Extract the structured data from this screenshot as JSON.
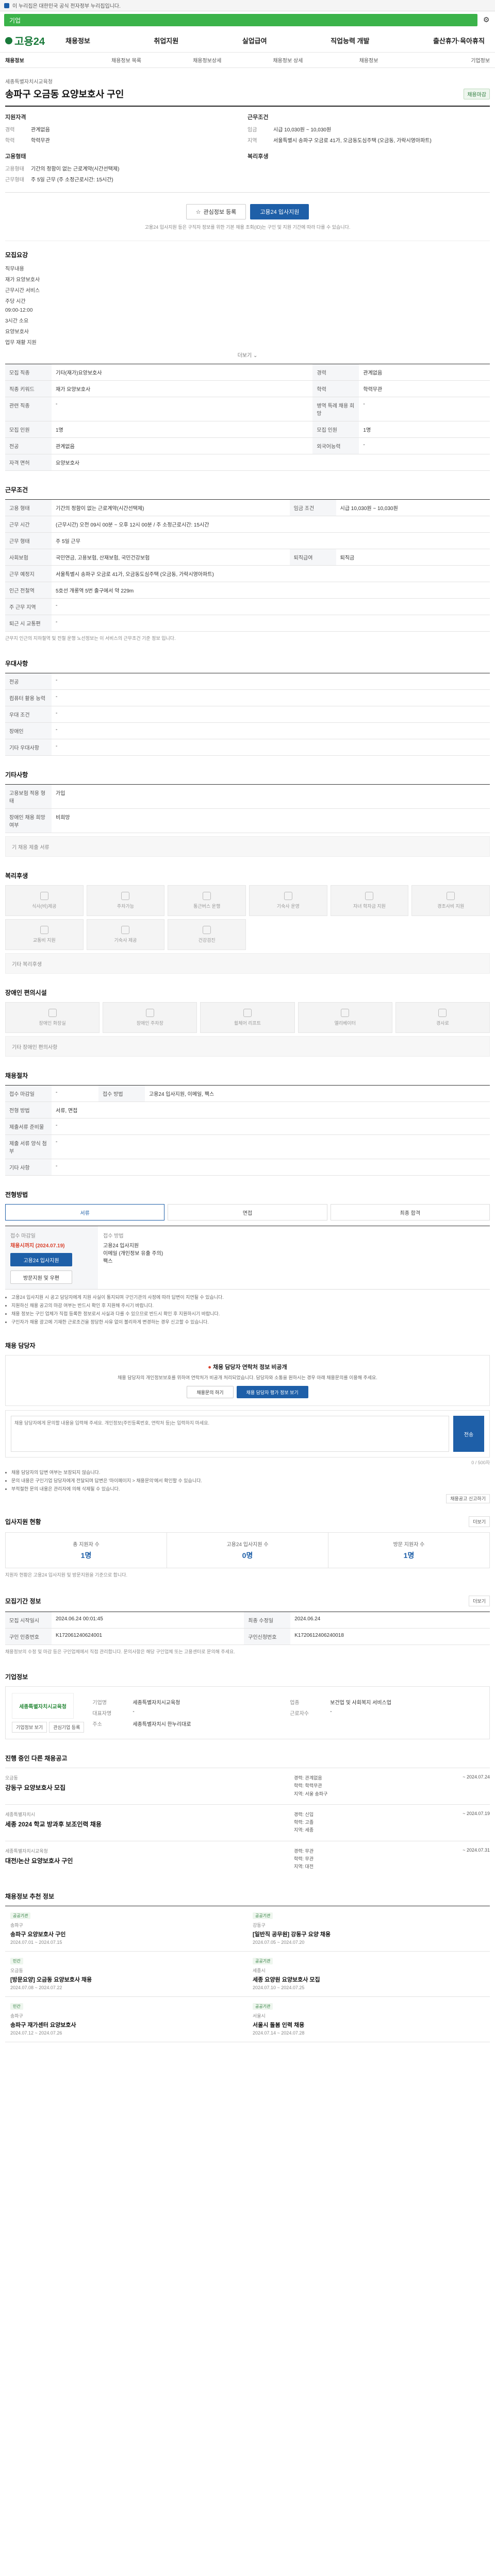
{
  "topbar": {
    "notice": "이 누리집은 대한민국 공식 전자정부 누리집입니다."
  },
  "search": {
    "placeholder": "기업"
  },
  "header": {
    "logo": "고용24",
    "gnb": [
      "채용정보",
      "취업지원",
      "실업급여",
      "직업능력 개발",
      "출산휴가·육아휴직"
    ]
  },
  "subnav": [
    "채용정보",
    "채용정보 목록",
    "채용정보상세",
    "채용정보 상세",
    "채용정보",
    "기업정보"
  ],
  "job": {
    "company": "세종특별자치시교육청",
    "title": "송파구 오금동 요양보호사 구인",
    "status": "채용마감",
    "summary_left_title": "지원자격",
    "summary_left": [
      {
        "k": "경력",
        "v": "관계없음"
      },
      {
        "k": "학력",
        "v": "학력무관"
      }
    ],
    "summary_right_title": "근무조건",
    "summary_right": [
      {
        "k": "임금",
        "v": "시급 10,030원 ~ 10,030원"
      },
      {
        "k": "지역",
        "v": "서울특별시 송파구 오금로 41가, 오금동도심주택 (오금동, 가락시영아파트)"
      }
    ],
    "summary_left2_title": "고용형태",
    "summary_left2": [
      {
        "k": "고용형태",
        "v": "기간의 정함이 없는 근로계약(시간선택제)"
      },
      {
        "k": "근무형태",
        "v": "주 5일 근무 (주 소정근로시간: 15시간)"
      }
    ],
    "summary_right2_title": "복리후생",
    "interest_btn": "관심정보 등록",
    "apply_btn": "고용24 입사지원",
    "notice": "고용24 입사지원 등은 구직자 정보를 위한 기본 채용 조회(ID)는 구인 및 지원 기간에 따라 다를 수 있습니다."
  },
  "duties": {
    "title": "모집요강",
    "lines": [
      "직무내용",
      "재가 요양보호사",
      "근무시간 서비스",
      "주당 시간",
      "09:00-12:00",
      "3시간 소요",
      "요양보호사",
      "업무 재활 지원"
    ],
    "more": "더보기"
  },
  "recruit_table": {
    "rows": [
      {
        "k": "모집 직종",
        "v": "기타(재가)요양보호사"
      },
      {
        "k": "직종 키워드",
        "v": "재가 요양보호사"
      },
      {
        "k": "관련 직종",
        "v": "-"
      },
      {
        "k": "모집 인원",
        "v": "1명"
      },
      {
        "k": "전공",
        "v": "관계없음"
      },
      {
        "k": "자격 면허",
        "v": "요양보호사"
      }
    ],
    "right_rows": [
      {
        "k": "경력",
        "v": "관계없음"
      },
      {
        "k": "학력",
        "v": "학력무관"
      },
      {
        "k": "병역 특례 채용 희망",
        "v": "-"
      },
      {
        "k": "모집 인원",
        "v": "1명"
      },
      {
        "k": "외국어능력",
        "v": "-"
      }
    ]
  },
  "conditions": {
    "title": "근무조건",
    "rows": [
      {
        "k": "고용 형태",
        "v": "기간의 정함이 없는 근로계약(시간선택제)"
      },
      {
        "k": "임금 조건",
        "v": "시급 10,030원 ~ 10,030원"
      },
      {
        "k": "근무 시간",
        "v": "(근무시간) 오전 09시 00분 ~ 오후 12시 00분 / 주 소정근로시간: 15시간"
      },
      {
        "k": "근무 형태",
        "v": "주 5일 근무"
      },
      {
        "k": "사회보험",
        "v": "국민연금, 고용보험, 산재보험, 국민건강보험"
      },
      {
        "k": "퇴직급여",
        "v": "퇴직금"
      },
      {
        "k": "근무 예정지",
        "v": "서울특별시 송파구 오금로 41가, 오금동도심주택 (오금동, 가락시영아파트)"
      },
      {
        "k": "인근 전철역",
        "v": "5호선 개롱역 5번 출구에서 약 229m"
      },
      {
        "k": "주 근무 지역",
        "v": "-"
      },
      {
        "k": "퇴근 시 교통편",
        "v": "-"
      }
    ],
    "note": "근무지 인근의 지하철역 및 전철 운행 노선정보는 이 서비스의 근무조건 기준 정보 입니다."
  },
  "pref": {
    "title": "우대사항",
    "rows": [
      {
        "k": "전공",
        "v": "-"
      },
      {
        "k": "컴퓨터 활용 능력",
        "v": "-"
      },
      {
        "k": "우대 조건",
        "v": "-"
      },
      {
        "k": "장애인",
        "v": "-"
      },
      {
        "k": "기타 우대사항",
        "v": "-"
      }
    ]
  },
  "other": {
    "title": "기타사항",
    "rows": [
      {
        "k": "고용보험 적용 형태",
        "v": "가입"
      },
      {
        "k": "장애인 채용 희망 여부",
        "v": "비희망"
      }
    ],
    "extra": "기 채용 제출 서류"
  },
  "welfare": {
    "title": "복리후생",
    "items": [
      "식사(비)제공",
      "주차가능",
      "통근버스 운행",
      "기숙사 운영",
      "자녀 학자금 지원",
      "경조사비 지원",
      "교통비 지원",
      "기숙사 제공",
      "건강검진"
    ],
    "extra": "기타 복리후생"
  },
  "disability": {
    "title": "장애인 편의시설",
    "items": [
      "장애인 화장실",
      "장애인 주차장",
      "휠체어 리프트",
      "엘리베이터",
      "경사로"
    ],
    "extra": "기타 장애인 편의사항"
  },
  "selection": {
    "title": "채용절차",
    "rows": [
      {
        "k": "접수 마감일",
        "v": "-"
      },
      {
        "k": "접수 방법",
        "v": "고용24 입사지원, 이메일, 팩스"
      },
      {
        "k": "전형 방법",
        "v": "서류, 면접"
      },
      {
        "k": "제출서류 준비물",
        "v": "-"
      },
      {
        "k": "제출 서류 양식 첨부",
        "v": "-"
      },
      {
        "k": "기타 사항",
        "v": "-"
      }
    ]
  },
  "apply_method": {
    "title": "전형방법",
    "tabs": [
      "서류",
      "면접",
      "최종 합격"
    ],
    "left_label": "접수 마감일",
    "left_date": "채용시까지 (2024.07.19)",
    "left_btn1": "고용24 입사지원",
    "left_btn2": "방문지원 및 우편",
    "right_label": "접수 방법",
    "right_lines": [
      "고용24 입사지원",
      "이메일 (개인정보 유출 주의)",
      "팩스"
    ],
    "bullets": [
      "고용24 입사지원 시 공고 담당자에게 지원 사실이 통지되며 구인기관의 사정에 따라 답변이 지연될 수 있습니다.",
      "지원하신 채용 공고의 마감 여부는 반드시 확인 후 지원해 주시기 바랍니다.",
      "채용 정보는 구인 업체가 직접 등록한 정보로서 사실과 다를 수 있으므로 반드시 확인 후 지원하시기 바랍니다.",
      "구인자가 채용 광고에 기재한 근로조건을 정당한 사유 없이 불리하게 변경하는 경우 신고할 수 있습니다."
    ]
  },
  "inquiry": {
    "title": "채용 담당자",
    "alert_title": "채용 담당자 연락처 정보 비공개",
    "alert_desc": "채용 담당자의 개인정보보호를 위하여 연락처가 비공개 처리되었습니다. 담당자와 소통을 원하시는 경우 아래 채용문의를 이용해 주세요.",
    "btn1": "채용문의 하기",
    "btn2": "채용 담당자 평가 정보 보기",
    "placeholder": "채용 담당자에게 문의할 내용을 입력해 주세요. 개인정보(주민등록번호, 연락처 등)는 입력하지 마세요.",
    "send": "전송",
    "counter": "0 / 500자",
    "bullets": [
      "채용 담당자의 답변 여부는 보장되지 않습니다.",
      "문의 내용은 구인기업 담당자에게 전달되며 답변은 '마이페이지 > 채용문의'에서 확인할 수 있습니다.",
      "부적절한 문의 내용은 관리자에 의해 삭제될 수 있습니다."
    ],
    "report_btn": "채용공고 신고하기"
  },
  "applicants": {
    "title": "입사지원 현황",
    "more": "더보기",
    "stats": [
      {
        "label": "총 지원자 수",
        "value": "1명"
      },
      {
        "label": "고용24 입사지원 수",
        "value": "0명"
      },
      {
        "label": "방문 지원자 수",
        "value": "1명"
      }
    ],
    "note": "지원자 현황은 고용24 입사지원 및 방문지원을 기준으로 합니다."
  },
  "info": {
    "title": "모집기간 정보",
    "more": "더보기",
    "rows": [
      {
        "k": "모집 시작일시",
        "v": "2024.06.24 00:01:45"
      },
      {
        "k": "최종 수정일",
        "v": "2024.06.24"
      },
      {
        "k": "구인 인증번호",
        "v": "K172061240624001"
      },
      {
        "k": "구인신청번호",
        "v": "K1720612406240018"
      }
    ],
    "note": "채용정보의 수정 및 마감 등은 구인업체에서 직접 관리합니다. 문의사항은 해당 구인업체 또는 고용센터로 문의해 주세요."
  },
  "company_info": {
    "title": "기업정보",
    "logo_text": "세종특별자치시교육청",
    "rows": [
      {
        "k": "기업명",
        "v": "세종특별자치시교육청"
      },
      {
        "k": "업종",
        "v": "보건업 및 사회복지 서비스업"
      },
      {
        "k": "대표자명",
        "v": "-"
      },
      {
        "k": "근로자수",
        "v": "-"
      },
      {
        "k": "주소",
        "v": "세종특별자치시 한누리대로"
      }
    ],
    "btn1": "기업정보 보기",
    "btn2": "관심기업 등록"
  },
  "other_jobs": {
    "title": "진행 중인 다른 채용공고",
    "items": [
      {
        "co": "오금동",
        "title": "강동구 요양보호사 모집",
        "m": [
          "경력: 관계없음",
          "학력: 학력무관",
          "지역: 서울 송파구"
        ],
        "r": "~ 2024.07.24"
      },
      {
        "co": "세종특별자치시",
        "title": "세종 2024 학교 방과후 보조인력 채용",
        "m": [
          "경력: 신입",
          "학력: 고졸",
          "지역: 세종"
        ],
        "r": "~ 2024.07.19"
      },
      {
        "co": "세종특별자치시교육청",
        "title": "대전/논산 요양보호사 구인",
        "m": [
          "경력: 무관",
          "학력: 무관",
          "지역: 대전"
        ],
        "r": "~ 2024.07.31"
      }
    ]
  },
  "similar": {
    "title": "채용정보 추천 정보",
    "items": [
      {
        "chip": "공공기관",
        "co": "송파구",
        "title": "송파구 요양보호사 구인",
        "meta": "2024.07.01 ~ 2024.07.15"
      },
      {
        "chip": "공공기관",
        "co": "강동구",
        "title": "[일반직 공무원] 강동구 요양 채용",
        "meta": "2024.07.05 ~ 2024.07.20"
      },
      {
        "chip": "민간",
        "co": "오금동",
        "title": "[방문요양] 오금동 요양보호사 채용",
        "meta": "2024.07.08 ~ 2024.07.22"
      },
      {
        "chip": "공공기관",
        "co": "세종시",
        "title": "세종 요양원 요양보호사 모집",
        "meta": "2024.07.10 ~ 2024.07.25"
      },
      {
        "chip": "민간",
        "co": "송파구",
        "title": "송파구 재가센터 요양보호사",
        "meta": "2024.07.12 ~ 2024.07.26"
      },
      {
        "chip": "공공기관",
        "co": "서울시",
        "title": "서울시 돌봄 인력 채용",
        "meta": "2024.07.14 ~ 2024.07.28"
      }
    ]
  }
}
